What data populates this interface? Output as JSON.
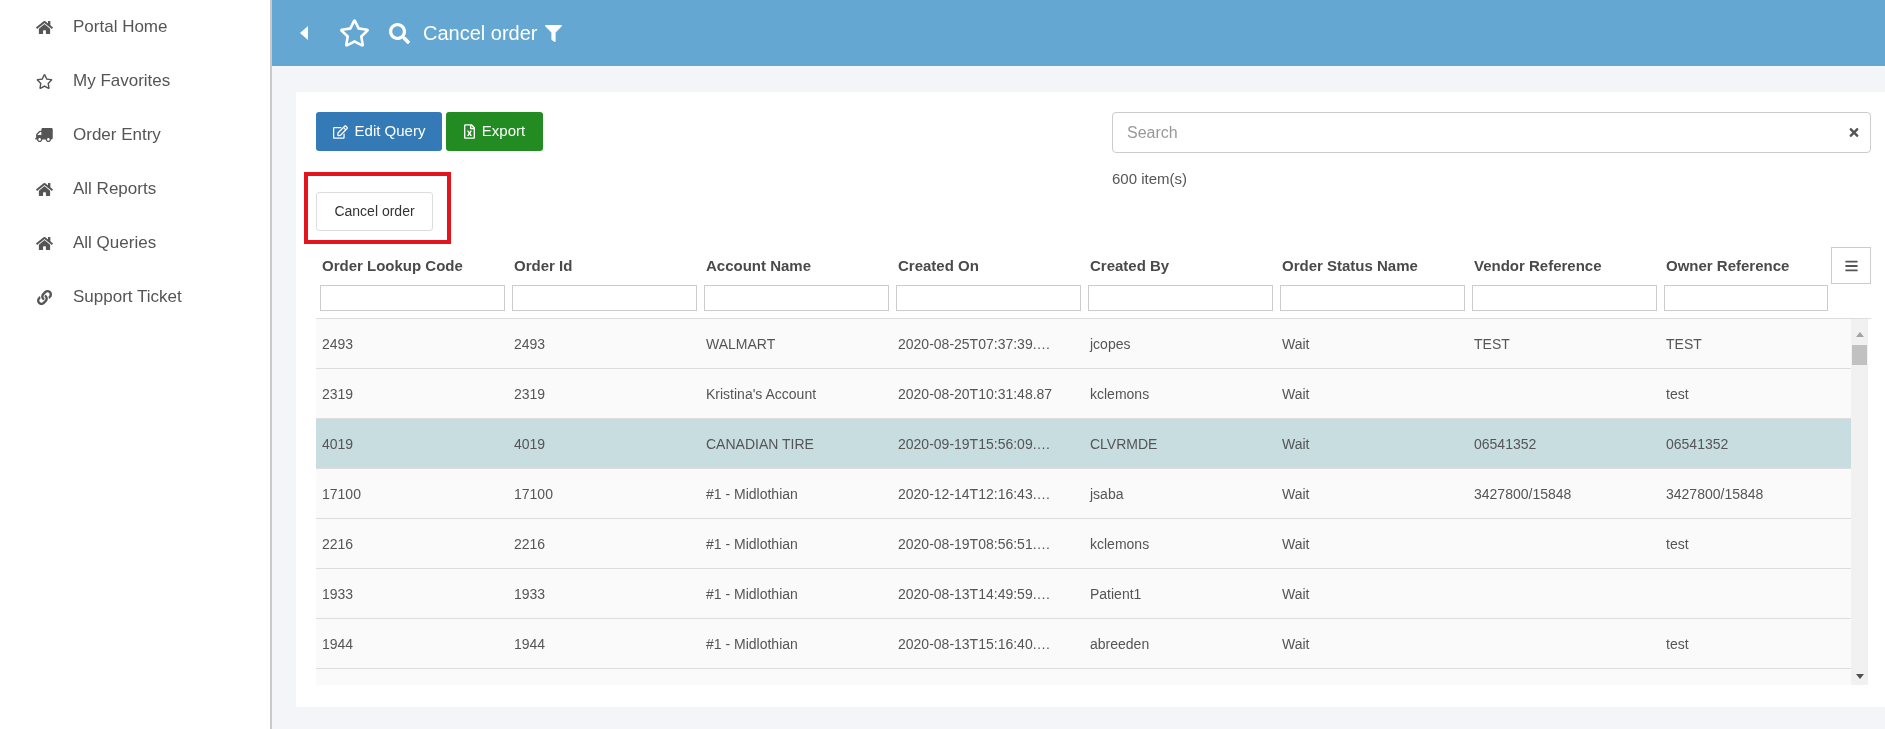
{
  "sidebar": {
    "items": [
      {
        "label": "Portal Home"
      },
      {
        "label": "My Favorites"
      },
      {
        "label": "Order Entry"
      },
      {
        "label": "All Reports"
      },
      {
        "label": "All Queries"
      },
      {
        "label": "Support Ticket"
      }
    ]
  },
  "header": {
    "title": "Cancel order"
  },
  "toolbar": {
    "buttons": [
      {
        "label": "Edit Query",
        "kind": "edit"
      },
      {
        "label": "Export",
        "kind": "export"
      }
    ],
    "search": {
      "placeholder": "Search"
    },
    "item_count": "600 item(s)"
  },
  "action_button": {
    "label": "Cancel order",
    "highlighted": true
  },
  "table": {
    "columns": [
      "Order Lookup Code",
      "Order Id",
      "Account Name",
      "Created On",
      "Created By",
      "Order Status Name",
      "Vendor Reference",
      "Owner Reference"
    ],
    "rows": [
      {
        "cells": [
          "2493",
          "2493",
          "WALMART",
          "2020-08-25T07:37:39.…",
          "jcopes",
          "Wait",
          "TEST",
          "TEST"
        ],
        "selected": false
      },
      {
        "cells": [
          "2319",
          "2319",
          "Kristina's Account",
          "2020-08-20T10:31:48.87",
          "kclemons",
          "Wait",
          null,
          "test"
        ],
        "selected": false
      },
      {
        "cells": [
          "4019",
          "4019",
          "CANADIAN TIRE",
          "2020-09-19T15:56:09.…",
          "CLVRMDE",
          "Wait",
          "06541352",
          "06541352"
        ],
        "selected": true
      },
      {
        "cells": [
          "17100",
          "17100",
          "#1 - Midlothian",
          "2020-12-14T12:16:43.…",
          "jsaba",
          "Wait",
          "3427800/15848",
          "3427800/15848"
        ],
        "selected": false
      },
      {
        "cells": [
          "2216",
          "2216",
          "#1 - Midlothian",
          "2020-08-19T08:56:51.…",
          "kclemons",
          "Wait",
          null,
          "test"
        ],
        "selected": false
      },
      {
        "cells": [
          "1933",
          "1933",
          "#1 - Midlothian",
          "2020-08-13T14:49:59.…",
          "Patient1",
          "Wait",
          null,
          null
        ],
        "selected": false
      },
      {
        "cells": [
          "1944",
          "1944",
          "#1 - Midlothian",
          "2020-08-13T15:16:40.…",
          "abreeden",
          "Wait",
          null,
          "test"
        ],
        "selected": false
      }
    ]
  }
}
